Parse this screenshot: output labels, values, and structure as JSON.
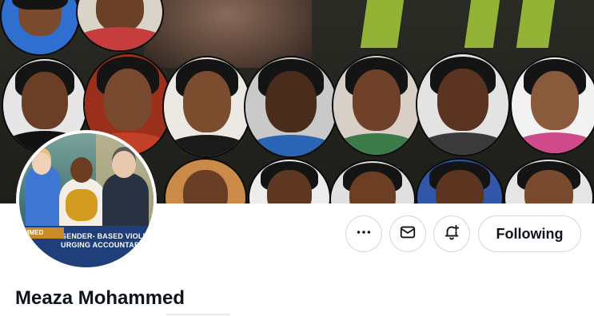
{
  "profile": {
    "display_name": "Meaza Mohammed"
  },
  "actions": {
    "more_icon": "more-horizontal-icon",
    "message_icon": "envelope-icon",
    "notify_icon": "bell-plus-icon",
    "follow_label": "Following"
  },
  "avatar_sign": {
    "left_text": "MMED",
    "line1": "GENDER- BASED VIOLENCE",
    "line2": "URGING ACCOUNTABILITY"
  }
}
